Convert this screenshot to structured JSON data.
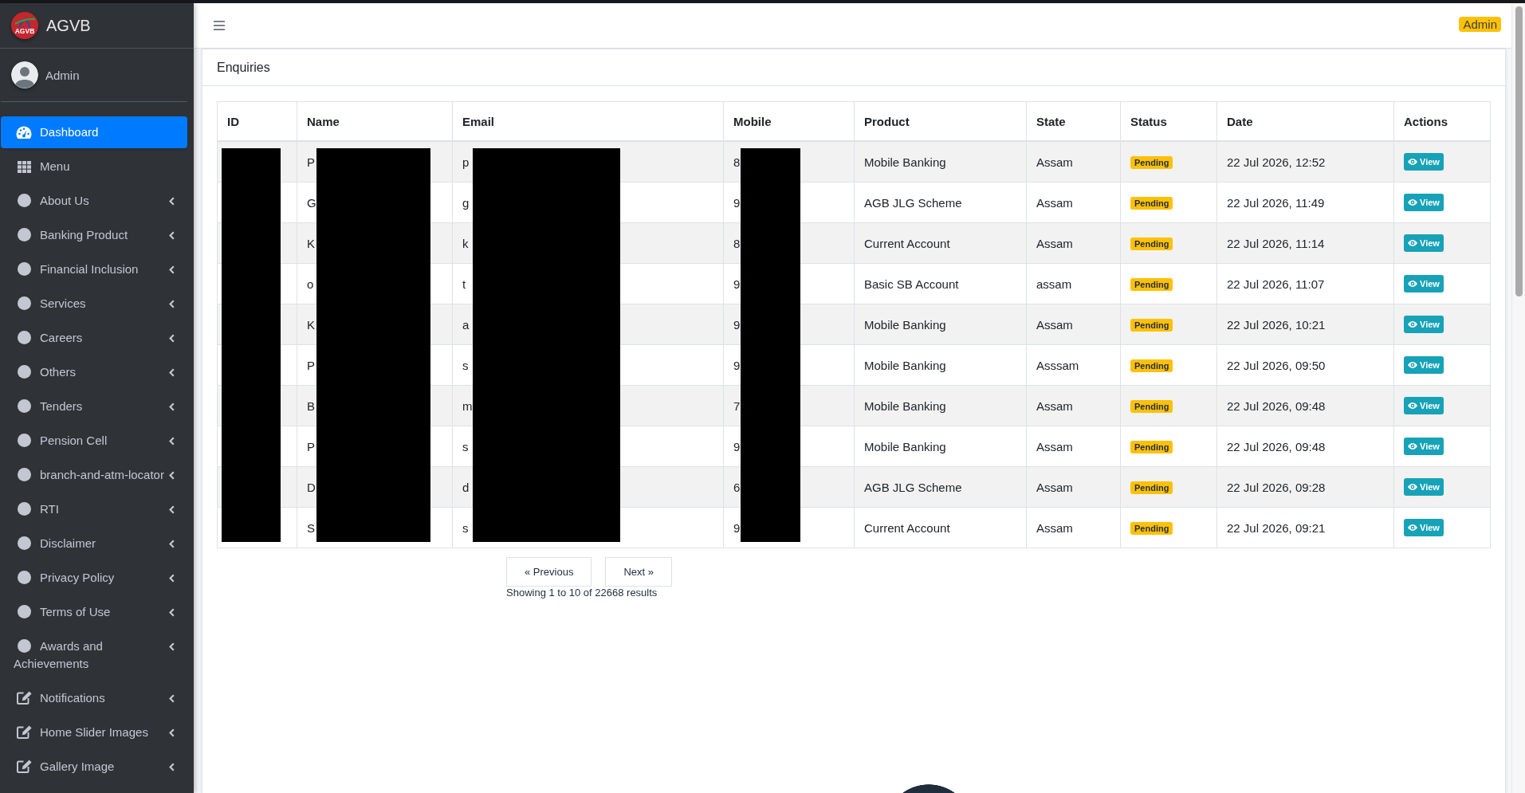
{
  "sidebar": {
    "brand": "AGVB",
    "logo_text": "AGVB",
    "user": "Admin",
    "items": [
      {
        "label": "Dashboard",
        "kind": "dashboard",
        "selected": true,
        "expandable": false
      },
      {
        "label": "Menu",
        "kind": "grid",
        "selected": false,
        "expandable": false
      },
      {
        "label": "About Us",
        "kind": "circle",
        "selected": false,
        "expandable": true
      },
      {
        "label": "Banking Product",
        "kind": "circle",
        "selected": false,
        "expandable": true
      },
      {
        "label": "Financial Inclusion",
        "kind": "circle",
        "selected": false,
        "expandable": true
      },
      {
        "label": "Services",
        "kind": "circle",
        "selected": false,
        "expandable": true
      },
      {
        "label": "Careers",
        "kind": "circle",
        "selected": false,
        "expandable": true
      },
      {
        "label": "Others",
        "kind": "circle",
        "selected": false,
        "expandable": true
      },
      {
        "label": "Tenders",
        "kind": "circle",
        "selected": false,
        "expandable": true
      },
      {
        "label": "Pension Cell",
        "kind": "circle",
        "selected": false,
        "expandable": true
      },
      {
        "label": "branch-and-atm-locator",
        "kind": "circle",
        "selected": false,
        "expandable": true
      },
      {
        "label": "RTI",
        "kind": "circle",
        "selected": false,
        "expandable": true
      },
      {
        "label": "Disclaimer",
        "kind": "circle",
        "selected": false,
        "expandable": true
      },
      {
        "label": "Privacy Policy",
        "kind": "circle",
        "selected": false,
        "expandable": true
      },
      {
        "label": "Terms of Use",
        "kind": "circle",
        "selected": false,
        "expandable": true
      },
      {
        "label": "Awards and Achievements",
        "kind": "circle",
        "selected": false,
        "expandable": true
      },
      {
        "label": "Notifications",
        "kind": "edit",
        "selected": false,
        "expandable": true
      },
      {
        "label": "Home Slider Images",
        "kind": "edit",
        "selected": false,
        "expandable": true
      },
      {
        "label": "Gallery Image",
        "kind": "edit",
        "selected": false,
        "expandable": true
      }
    ]
  },
  "navbar": {
    "badge": "Admin"
  },
  "card": {
    "title": "Enquiries"
  },
  "table": {
    "columns": [
      {
        "label": "ID",
        "redacted": true
      },
      {
        "label": "Name",
        "redacted": true
      },
      {
        "label": "Email",
        "redacted": true
      },
      {
        "label": "Mobile",
        "redacted": true
      },
      {
        "label": "Product"
      },
      {
        "label": "State"
      },
      {
        "label": "Status"
      },
      {
        "label": "Date"
      },
      {
        "label": "Actions"
      }
    ],
    "rows": [
      {
        "name": "P",
        "email": "p",
        "mobile": "8",
        "product": "Mobile Banking",
        "state": "Assam",
        "status": "Pending",
        "date": "22 Jul 2026, 12:52",
        "action": "View"
      },
      {
        "name": "G",
        "email": "g",
        "mobile": "9",
        "product": "AGB JLG Scheme",
        "state": "Assam",
        "status": "Pending",
        "date": "22 Jul 2026, 11:49",
        "action": "View"
      },
      {
        "name": "K",
        "email": "k",
        "mobile": "8",
        "product": "Current Account",
        "state": "Assam",
        "status": "Pending",
        "date": "22 Jul 2026, 11:14",
        "action": "View"
      },
      {
        "name": "o",
        "email": "t",
        "mobile": "9",
        "product": "Basic SB Account",
        "state": "assam",
        "status": "Pending",
        "date": "22 Jul 2026, 11:07",
        "action": "View"
      },
      {
        "name": "K",
        "email": "a",
        "mobile": "9",
        "product": "Mobile Banking",
        "state": "Assam",
        "status": "Pending",
        "date": "22 Jul 2026, 10:21",
        "action": "View"
      },
      {
        "name": "P",
        "email": "s",
        "mobile": "9",
        "product": "Mobile Banking",
        "state": "Asssam",
        "status": "Pending",
        "date": "22 Jul 2026, 09:50",
        "action": "View"
      },
      {
        "name": "B",
        "email": "m",
        "mobile": "7",
        "product": "Mobile Banking",
        "state": "Assam",
        "status": "Pending",
        "date": "22 Jul 2026, 09:48",
        "action": "View"
      },
      {
        "name": "P",
        "email": "s",
        "mobile": "9",
        "product": "Mobile Banking",
        "state": "Assam",
        "status": "Pending",
        "date": "22 Jul 2026, 09:48",
        "action": "View"
      },
      {
        "name": "D",
        "email": "d",
        "mobile": "6",
        "product": "AGB JLG Scheme",
        "state": "Assam",
        "status": "Pending",
        "date": "22 Jul 2026, 09:28",
        "action": "View"
      },
      {
        "name": "S",
        "email": "s",
        "mobile": "9",
        "product": "Current Account",
        "state": "Assam",
        "status": "Pending",
        "date": "22 Jul 2026, 09:21",
        "action": "View"
      }
    ]
  },
  "pagination": {
    "previous": "« Previous",
    "next": "Next »",
    "summary": "Showing 1 to 10 of 22668 results"
  }
}
